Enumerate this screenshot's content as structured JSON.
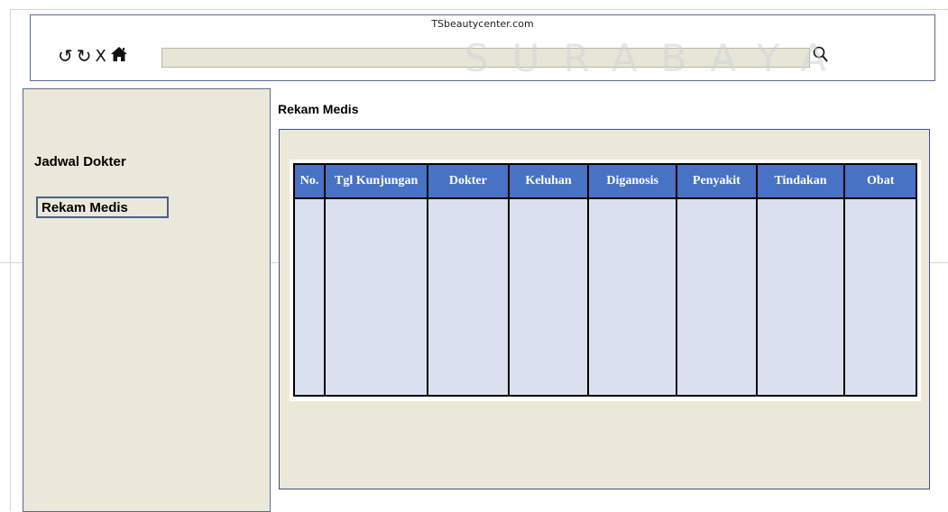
{
  "watermark": "SURABAYA",
  "browser": {
    "site_title": "TSbeautycenter.com",
    "address_value": ""
  },
  "icons": {
    "back": "undo-icon",
    "refresh": "refresh-icon",
    "stop": "close-icon",
    "home": "home-icon",
    "search": "search-icon"
  },
  "sidebar": {
    "items": [
      {
        "label": "Jadwal Dokter"
      },
      {
        "label": "Rekam Medis"
      }
    ]
  },
  "main": {
    "title": "Rekam Medis",
    "table": {
      "columns": [
        "No.",
        "Tgl Kunjungan",
        "Dokter",
        "Keluhan",
        "Diganosis",
        "Penyakit",
        "Tindakan",
        "Obat"
      ],
      "rows": []
    }
  },
  "colors": {
    "header_blue": "#4872c4",
    "panel_beige": "#ebe8da",
    "cell_blue": "#d9e1f1"
  }
}
